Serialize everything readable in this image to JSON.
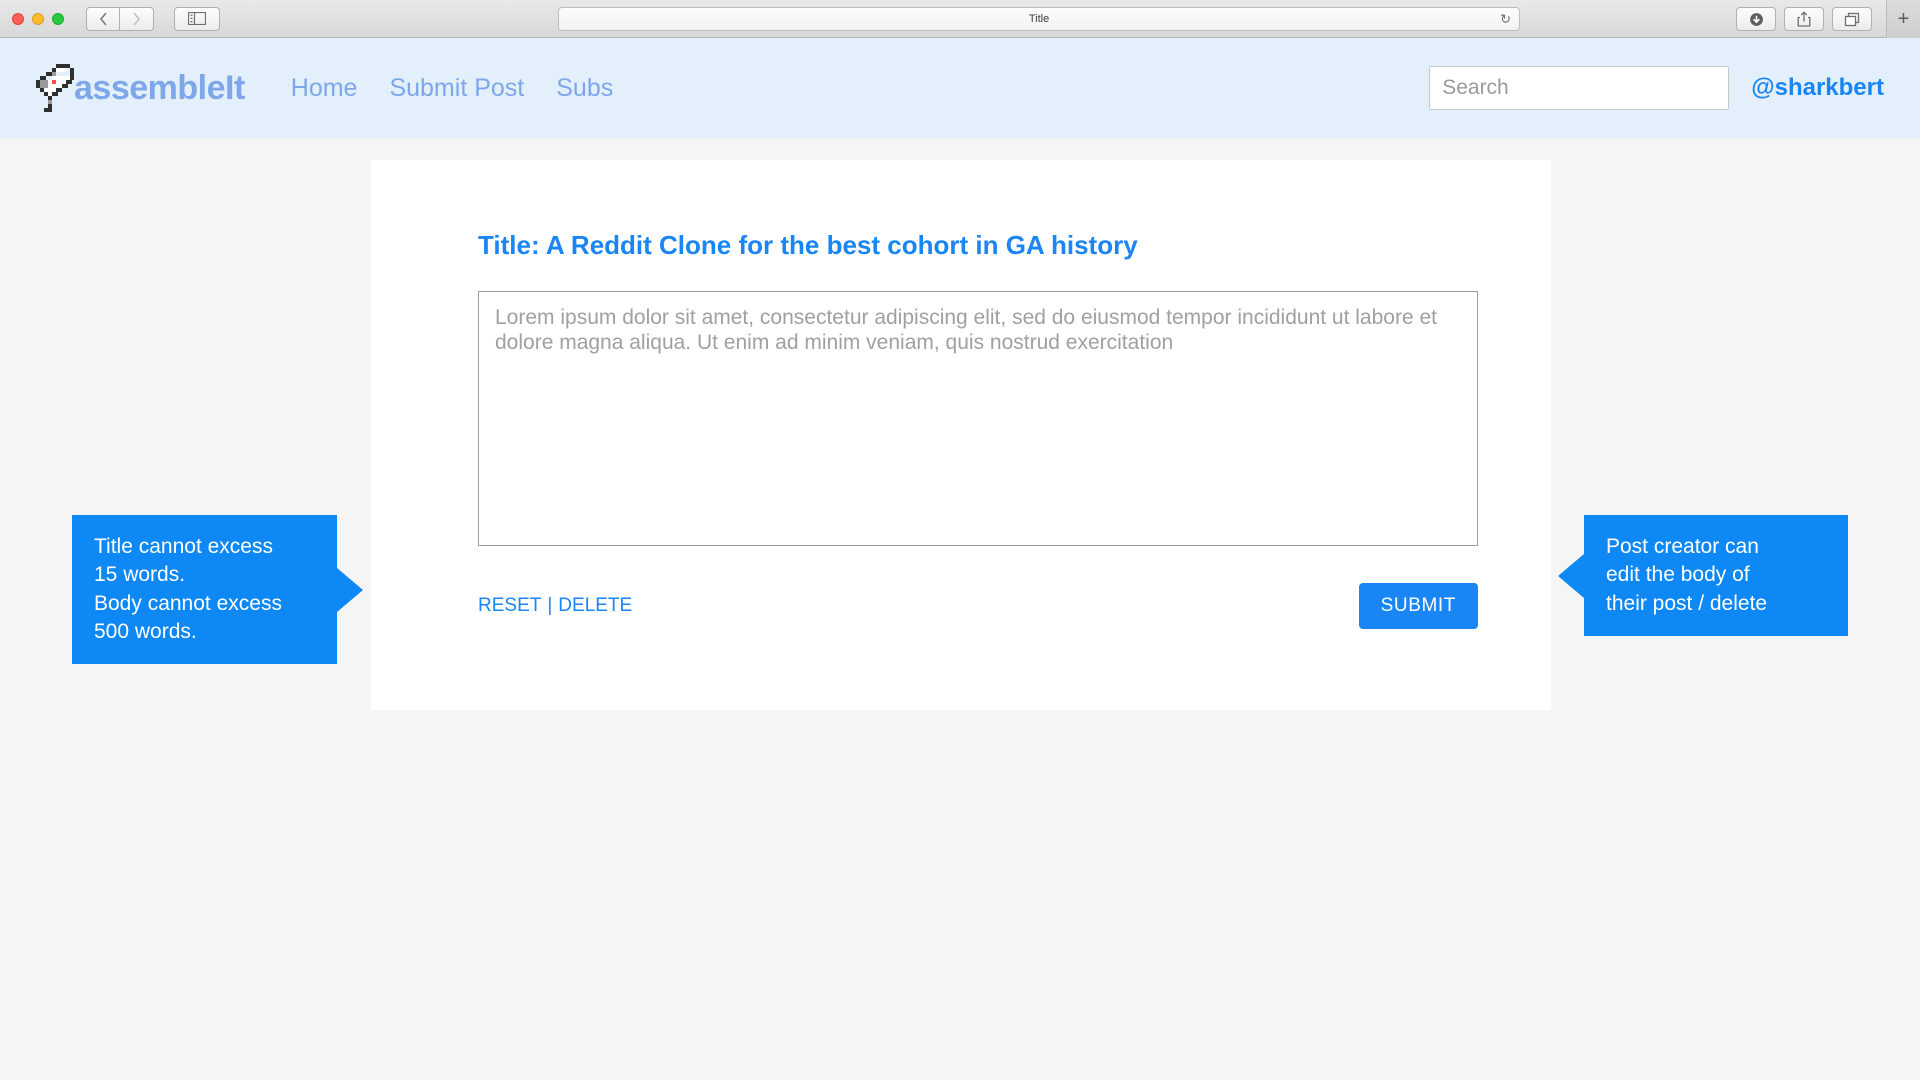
{
  "browser": {
    "traffic_lights": [
      "close",
      "minimize",
      "maximize"
    ],
    "back_label": "‹",
    "forward_label": "›",
    "sidebar_icon": "sidebar-icon",
    "address_title": "Title",
    "reload_icon": "↻",
    "download_icon": "download-icon",
    "share_icon": "share-icon",
    "tabs_icon": "tabs-icon",
    "newtab_label": "+"
  },
  "header": {
    "logo_icon": "shark-logo-icon",
    "brand": "assembleIt",
    "nav": [
      {
        "label": "Home"
      },
      {
        "label": "Submit Post"
      },
      {
        "label": "Subs"
      }
    ],
    "search": {
      "placeholder": "Search",
      "value": ""
    },
    "username": "@sharkbert",
    "background_color": "#e3f0fb",
    "brand_color": "#7da7ea",
    "username_color": "#1a85f5"
  },
  "post": {
    "title": "Title: A Reddit Clone for the best cohort in GA history",
    "body_text": "Lorem ipsum dolor sit amet, consectetur adipiscing elit, sed do eiusmod tempor incididunt ut labore et dolore magna aliqua. Ut enim ad minim veniam, quis nostrud exercitation ",
    "body_placeholder": "",
    "reset_label": "RESET",
    "separator": "|",
    "delete_label": "DELETE",
    "submit_label": "SUBMIT",
    "accent_color": "#1a85f5"
  },
  "annotations": {
    "left": {
      "text": "Title cannot excess\n15 words.\nBody cannot excess\n500 words.",
      "color": "#0d88f5"
    },
    "right": {
      "text": "Post creator can\nedit the body of\ntheir post / delete",
      "color": "#0d88f5"
    }
  }
}
